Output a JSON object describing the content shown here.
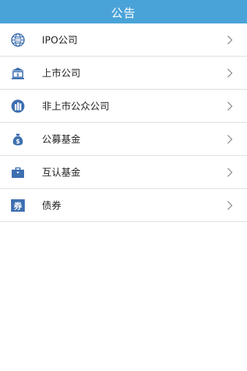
{
  "header": {
    "title": "公告"
  },
  "accent_color": "#4aa3d8",
  "icon_color": "#3d6fb0",
  "menu": {
    "items": [
      {
        "label": "IPO公司",
        "icon": "globe-icon"
      },
      {
        "label": "上市公司",
        "icon": "bank-icon"
      },
      {
        "label": "非上市公众公司",
        "icon": "building-icon"
      },
      {
        "label": "公募基金",
        "icon": "money-bag-icon"
      },
      {
        "label": "互认基金",
        "icon": "briefcase-icon"
      },
      {
        "label": "债券",
        "icon": "bond-icon"
      }
    ]
  }
}
